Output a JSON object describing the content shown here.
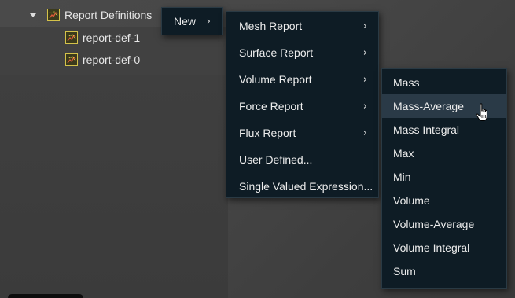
{
  "tree": {
    "parent_label": "Report Definitions",
    "children": [
      "report-def-1",
      "report-def-0"
    ]
  },
  "menu_new": {
    "label": "New",
    "chevron": "›"
  },
  "menu_category": {
    "items": [
      {
        "label": "Mesh Report",
        "submenu": true
      },
      {
        "label": "Surface Report",
        "submenu": true
      },
      {
        "label": "Volume Report",
        "submenu": true
      },
      {
        "label": "Force Report",
        "submenu": true
      },
      {
        "label": "Flux Report",
        "submenu": true
      },
      {
        "label": "User Defined...",
        "submenu": false
      },
      {
        "label": "Single Valued Expression...",
        "submenu": false
      }
    ],
    "chevron": "›"
  },
  "menu_volume": {
    "items": [
      "Mass",
      "Mass-Average",
      "Mass Integral",
      "Max",
      "Min",
      "Volume",
      "Volume-Average",
      "Volume Integral",
      "Sum"
    ],
    "hovered": "Mass-Average"
  },
  "colors": {
    "menu_bg": "#0e1c25",
    "menu_hover": "#2a3a47",
    "icon_border": "#d4c24a"
  }
}
